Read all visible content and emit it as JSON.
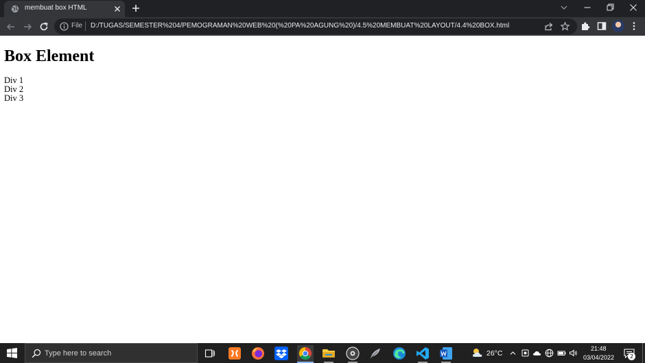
{
  "browser": {
    "tab": {
      "title": "membuat box HTML"
    },
    "address": {
      "scheme_label": "File",
      "url": "D:/TUGAS/SEMESTER%204/PEMOGRAMAN%20WEB%20(%20PA%20AGUNG%20)/4.5%20MEMBUAT%20LAYOUT/4.4%20BOX.html"
    }
  },
  "page": {
    "heading": "Box Element",
    "boxes": [
      "Div 1",
      "Div 2",
      "Div 3"
    ]
  },
  "taskbar": {
    "search_placeholder": "Type here to search",
    "weather_temp": "26°C",
    "clock_time": "21:48",
    "clock_date": "03/04/2022",
    "notification_count": "2"
  },
  "colors": {
    "chrome_dark": "#202124",
    "chrome_toolbar": "#35363a",
    "taskbar": "#202020",
    "accent": "#8ab4f8"
  }
}
